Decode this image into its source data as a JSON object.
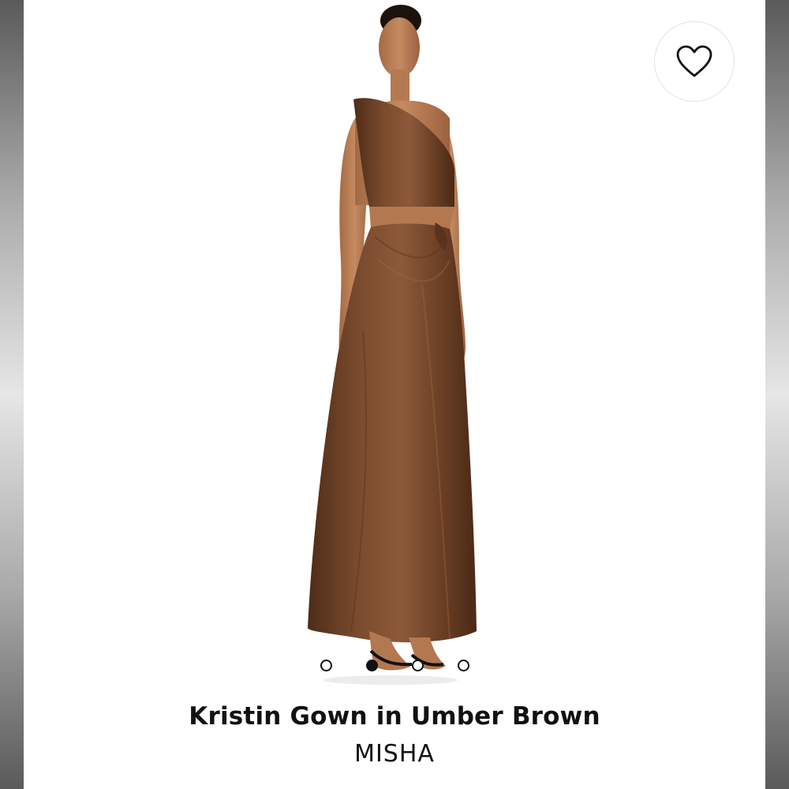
{
  "product": {
    "title": "Kristin Gown in Umber Brown",
    "brand": "MISHA",
    "color": "#6b4128"
  },
  "favorite": {
    "icon": "heart-icon",
    "active": false
  },
  "carousel": {
    "total": 4,
    "active_index": 1
  }
}
